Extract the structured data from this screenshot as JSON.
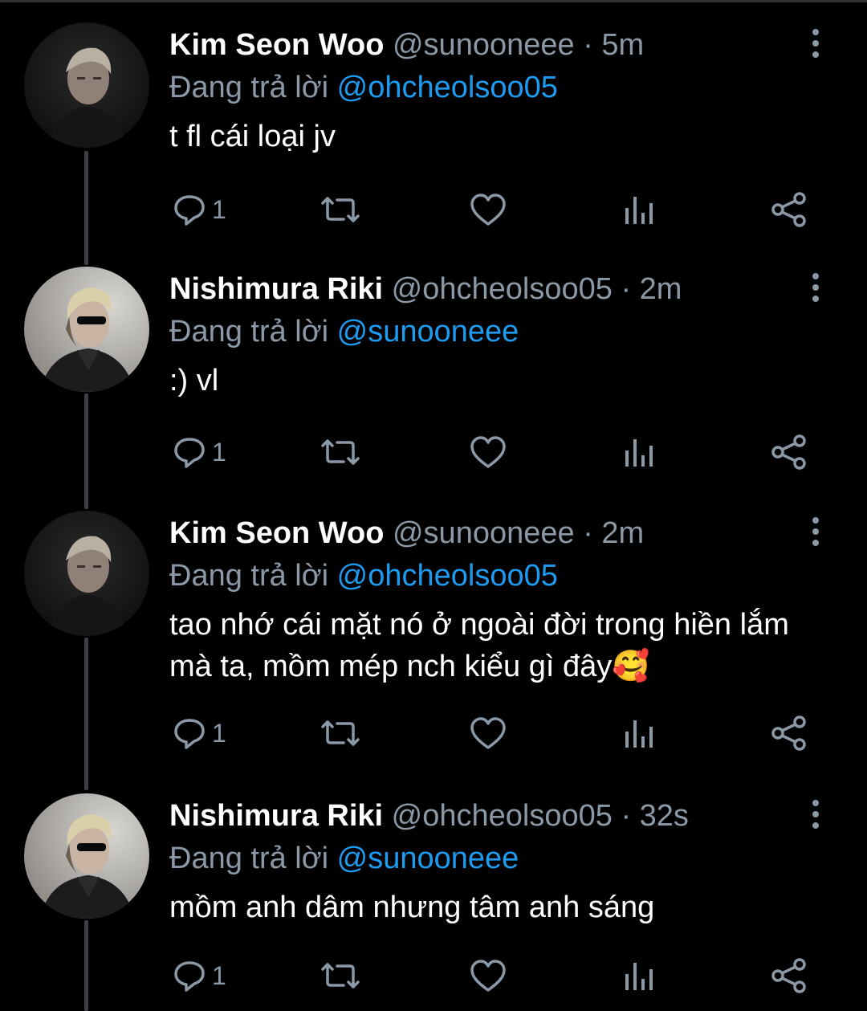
{
  "colors": {
    "background": "#000000",
    "text_primary": "#ffffff",
    "text_secondary": "#8b98a5",
    "mention": "#1d9bf0",
    "thread_line": "#3d4145"
  },
  "reply_prefix": "Đang trả lời",
  "tweets": [
    {
      "name": "Kim Seon Woo",
      "handle": "@sunooneee",
      "separator": "·",
      "time": "5m",
      "reply_to": "@ohcheolsoo05",
      "text": "t fl cái loại jv",
      "reply_count": "1",
      "avatar": "avatar-kim-seon-woo"
    },
    {
      "name": "Nishimura Riki",
      "handle": "@ohcheolsoo05",
      "separator": "·",
      "time": "2m",
      "reply_to": "@sunooneee",
      "text": ":) vl",
      "reply_count": "1",
      "avatar": "avatar-nishimura-riki"
    },
    {
      "name": "Kim Seon Woo",
      "handle": "@sunooneee",
      "separator": "·",
      "time": "2m",
      "reply_to": "@ohcheolsoo05",
      "text": "tao nhớ cái mặt nó ở ngoài đời trong hiền lắm mà ta, mồm mép nch kiểu gì đây🥰",
      "reply_count": "1",
      "avatar": "avatar-kim-seon-woo"
    },
    {
      "name": "Nishimura Riki",
      "handle": "@ohcheolsoo05",
      "separator": "·",
      "time": "32s",
      "reply_to": "@sunooneee",
      "text": "mồm anh dâm nhưng tâm anh sáng",
      "reply_count": "1",
      "avatar": "avatar-nishimura-riki"
    }
  ],
  "icons": [
    "reply-icon",
    "retweet-icon",
    "like-icon",
    "views-icon",
    "share-icon",
    "more-icon"
  ]
}
